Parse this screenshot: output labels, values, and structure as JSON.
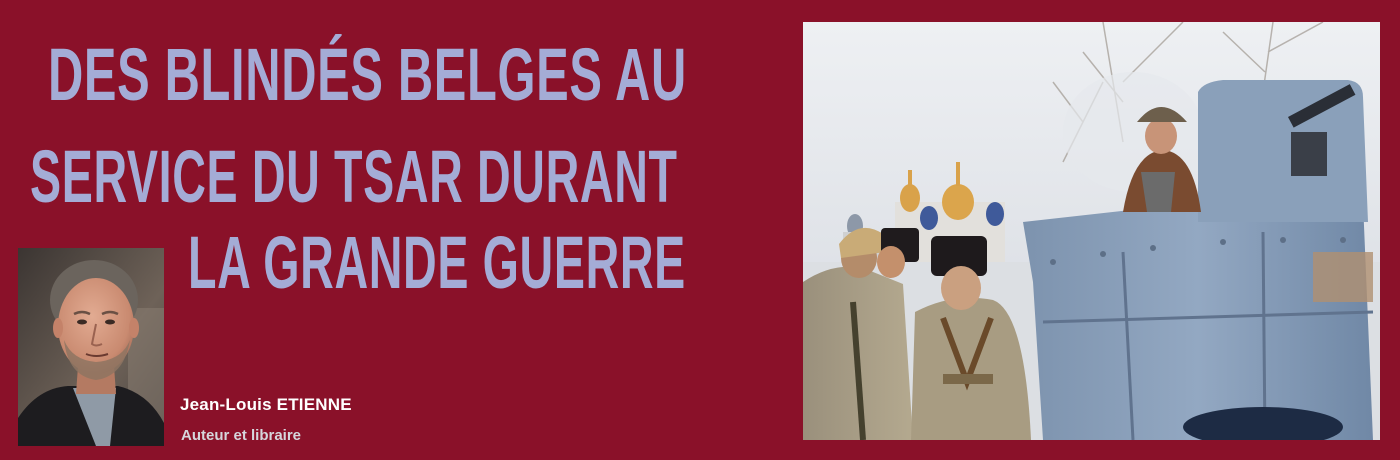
{
  "headline": {
    "line1": "DES BLINDÉS BELGES AU",
    "line2": "SERVICE DU TSAR DURANT",
    "line3": "LA GRANDE GUERRE"
  },
  "author": {
    "name": "Jean-Louis ETIENNE",
    "role": "Auteur et libraire"
  },
  "colors": {
    "background": "#8a1129",
    "headline": "#a4acd6",
    "author_name": "#ffffff",
    "author_role": "#d6d6dc"
  }
}
